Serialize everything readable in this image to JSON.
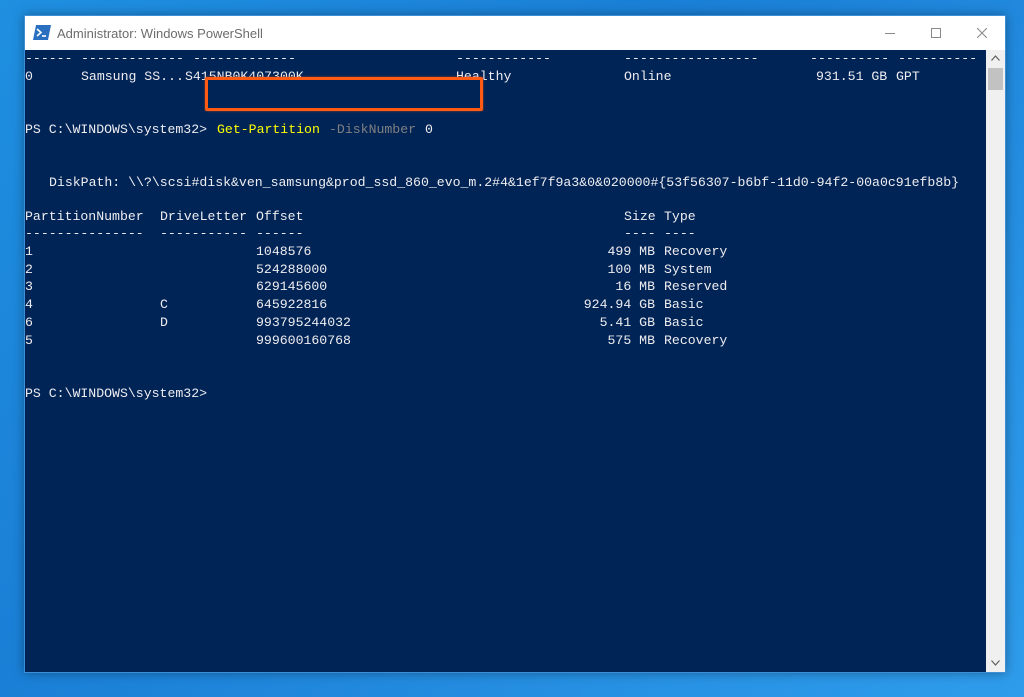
{
  "window": {
    "title": "Administrator: Windows PowerShell"
  },
  "disk_table": {
    "separators": [
      "------",
      "-------------",
      "-------------",
      "------------",
      "-----------------",
      "----------",
      "----------"
    ],
    "row": {
      "number": "0",
      "name": "Samsung SS...",
      "serial": "S415NB0K407300K",
      "health": "Healthy",
      "status": "Online",
      "size": "931.51 GB",
      "style": "GPT"
    }
  },
  "command": {
    "prompt": "PS C:\\WINDOWS\\system32>",
    "cmdlet": "Get-Partition",
    "parameter": "-DiskNumber",
    "argument": "0"
  },
  "disk_path": "DiskPath: \\\\?\\scsi#disk&ven_samsung&prod_ssd_860_evo_m.2#4&1ef7f9a3&0&020000#{53f56307-b6bf-11d0-94f2-00a0c91efb8b}",
  "partitions": {
    "headers": {
      "number": "PartitionNumber",
      "letter": "DriveLetter",
      "offset": "Offset",
      "size": "Size",
      "type": "Type"
    },
    "separators": {
      "number": "---------------",
      "letter": "-----------",
      "offset": "------",
      "size": "----",
      "type": "----"
    },
    "rows": [
      {
        "number": "1",
        "letter": "",
        "offset": "1048576",
        "size": "499 MB",
        "type": "Recovery"
      },
      {
        "number": "2",
        "letter": "",
        "offset": "524288000",
        "size": "100 MB",
        "type": "System"
      },
      {
        "number": "3",
        "letter": "",
        "offset": "629145600",
        "size": "16 MB",
        "type": "Reserved"
      },
      {
        "number": "4",
        "letter": "C",
        "offset": "645922816",
        "size": "924.94 GB",
        "type": "Basic"
      },
      {
        "number": "6",
        "letter": "D",
        "offset": "993795244032",
        "size": "5.41 GB",
        "type": "Basic"
      },
      {
        "number": "5",
        "letter": "",
        "offset": "999600160768",
        "size": "575 MB",
        "type": "Recovery"
      }
    ]
  },
  "final_prompt": "PS C:\\WINDOWS\\system32>",
  "colors": {
    "console_bg": "#012456",
    "console_text": "#eeedf0",
    "cmdlet": "#ffff00",
    "parameter": "#808080",
    "highlight": "#ff5a14"
  }
}
